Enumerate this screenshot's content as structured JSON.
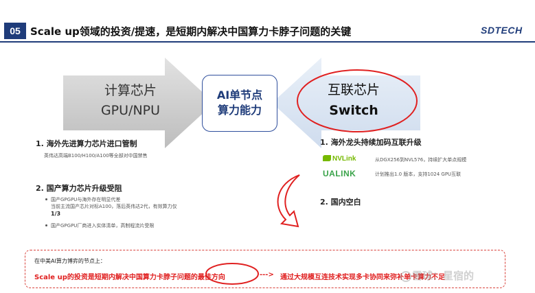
{
  "header": {
    "section_number": "05",
    "title": "Scale up领域的投资/提速，是短期内解决中国算力卡脖子问题的关键",
    "logo": "SDTECH"
  },
  "diagram": {
    "left_label_line1": "计算芯片",
    "left_label_line2": "GPU/NPU",
    "center_line1": "AI单节点",
    "center_line2": "算力能力",
    "right_label_line1": "互联芯片",
    "right_label_line2": "Switch"
  },
  "left": {
    "s1_title": "1. 海外先进算力芯片进口管制",
    "s1_text": "英伟达高端B100/H100/A100等全部对中国禁售",
    "s2_title": "2. 国产算力芯片升级受阻",
    "s2_b1": "国产GPGPU与海外存在明显代差",
    "s2_b1b": "当前主流国产芯片对标A100，落后英伟达2代，有效算力仅",
    "s2_b1c": "1/3",
    "s2_b2": "国产GPGPU厂商进入实体清单，高制程流片受限"
  },
  "right": {
    "s1_title": "1. 海外龙头持续加码互联升级",
    "nv_logo": "NVLink",
    "nv_text": "从DGX256到NVL576，持续扩大单点规模",
    "ua_logo": "UALINK",
    "ua_text": "计划推出1.0 版本，支持1024 GPU互联",
    "s2_title": "2. 国内空白"
  },
  "bottom": {
    "intro": "在中美AI算力博弈的节点上：",
    "conclusion": "Scale up的投资是短期内解决中国算力卡脖子问题的最佳方向",
    "arrow": "--->",
    "result": "通过大规模互连技术实现多卡协同来弥补单卡算力不足"
  },
  "watermark": "雪球：星宿的",
  "colors": {
    "brand_navy": "#1f3c7a",
    "accent_red": "#e02020",
    "arrow_gray": "#cccccc",
    "arrow_blue": "#dbe6f4",
    "nvidia_green": "#76b900",
    "ualink_green": "#3aa34a"
  }
}
